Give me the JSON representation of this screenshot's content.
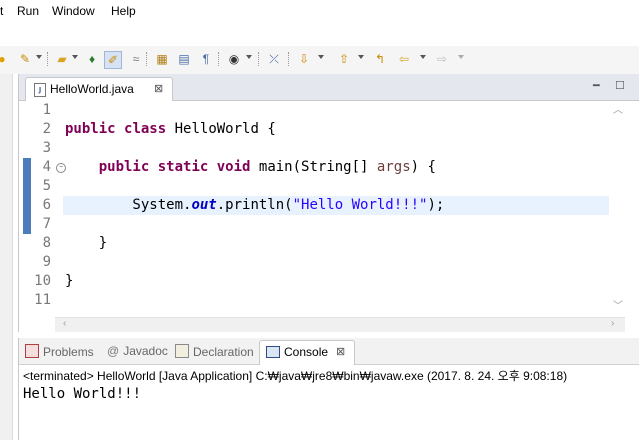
{
  "menubar": {
    "items": [
      "t",
      "Run",
      "Window",
      "Help"
    ]
  },
  "toolbar": {
    "icons": [
      "new-wizard-icon",
      "edit-icon",
      "open-folder-icon",
      "pin-icon",
      "highlight-icon",
      "format-icon",
      "package-icon",
      "page-icon",
      "paragraph-icon",
      "run-icon",
      "stop-icon",
      "next-annotation-icon",
      "prev-annotation-icon",
      "back-icon",
      "forward-icon"
    ]
  },
  "editor": {
    "tab_label": "HelloWorld.java",
    "close_glyph": "⊠",
    "lines": [
      {
        "no": "1",
        "tokens": []
      },
      {
        "no": "2",
        "tokens": [
          {
            "t": "public",
            "c": "kw"
          },
          {
            "t": " ",
            "c": ""
          },
          {
            "t": "class",
            "c": "kw"
          },
          {
            "t": " HelloWorld {",
            "c": ""
          }
        ]
      },
      {
        "no": "3",
        "tokens": []
      },
      {
        "no": "4",
        "tokens": [
          {
            "t": "    ",
            "c": ""
          },
          {
            "t": "public",
            "c": "kw"
          },
          {
            "t": " ",
            "c": ""
          },
          {
            "t": "static",
            "c": "kw"
          },
          {
            "t": " ",
            "c": ""
          },
          {
            "t": "void",
            "c": "kw"
          },
          {
            "t": " main(String[] ",
            "c": ""
          },
          {
            "t": "args",
            "c": "param"
          },
          {
            "t": ") {",
            "c": ""
          }
        ]
      },
      {
        "no": "5",
        "tokens": []
      },
      {
        "no": "6",
        "tokens": [
          {
            "t": "        System.",
            "c": ""
          },
          {
            "t": "out",
            "c": "field"
          },
          {
            "t": ".println(",
            "c": ""
          },
          {
            "t": "\"Hello World!!!\"",
            "c": "str"
          },
          {
            "t": ");",
            "c": ""
          }
        ]
      },
      {
        "no": "7",
        "tokens": []
      },
      {
        "no": "8",
        "tokens": [
          {
            "t": "    }",
            "c": ""
          }
        ]
      },
      {
        "no": "9",
        "tokens": []
      },
      {
        "no": "10",
        "tokens": [
          {
            "t": "}",
            "c": ""
          }
        ]
      },
      {
        "no": "11",
        "tokens": []
      }
    ]
  },
  "bottom_panel": {
    "tabs": [
      {
        "label": "Problems"
      },
      {
        "label": "Javadoc"
      },
      {
        "label": "Declaration"
      },
      {
        "label": "Console"
      }
    ],
    "status": "<terminated> HelloWorld [Java Application] C:₩java₩jre8₩bin₩javaw.exe (2017. 8. 24. 오후 9:08:18)",
    "output": "Hello World!!!"
  }
}
